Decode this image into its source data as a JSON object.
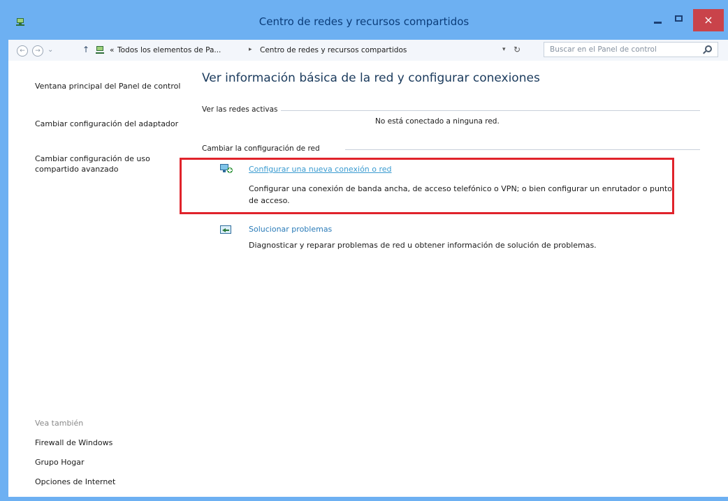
{
  "window": {
    "title": "Centro de redes y recursos compartidos",
    "close_glyph": "×"
  },
  "address": {
    "crumb_prefix": "«",
    "crumb_1": "Todos los elementos de Pa...",
    "crumb_sep": "▸",
    "crumb_2": "Centro de redes y recursos compartidos",
    "search_placeholder": "Buscar en el Panel de control"
  },
  "sidebar": {
    "links": [
      "Ventana principal del Panel de control",
      "Cambiar configuración del adaptador",
      "Cambiar configuración de uso compartido avanzado"
    ],
    "see_also_title": "Vea también",
    "see_also_links": [
      "Firewall de Windows",
      "Grupo Hogar",
      "Opciones de Internet"
    ]
  },
  "main": {
    "title": "Ver información básica de la red y configurar conexiones",
    "active_networks_label": "Ver las redes activas",
    "no_network_status": "No está conectado a ninguna red.",
    "change_settings_label": "Cambiar la configuración de red",
    "tasks": [
      {
        "title": "Configurar una nueva conexión o red",
        "description": "Configurar una conexión de banda ancha, de acceso telefónico o VPN; o bien configurar un enrutador o punto de acceso."
      },
      {
        "title": "Solucionar problemas",
        "description": "Diagnosticar y reparar problemas de red u obtener información de solución de problemas."
      }
    ]
  },
  "icons": {
    "app": "network-center-icon",
    "back": "back-arrow-icon",
    "forward": "forward-arrow-icon",
    "up": "up-arrow-icon",
    "search": "search-icon",
    "task_1": "network-setup-icon",
    "task_2": "troubleshoot-icon"
  },
  "colors": {
    "titlebar": "#6db0f2",
    "link": "#2a7bb8",
    "highlight": "#e0232b",
    "close": "#c9434a"
  }
}
